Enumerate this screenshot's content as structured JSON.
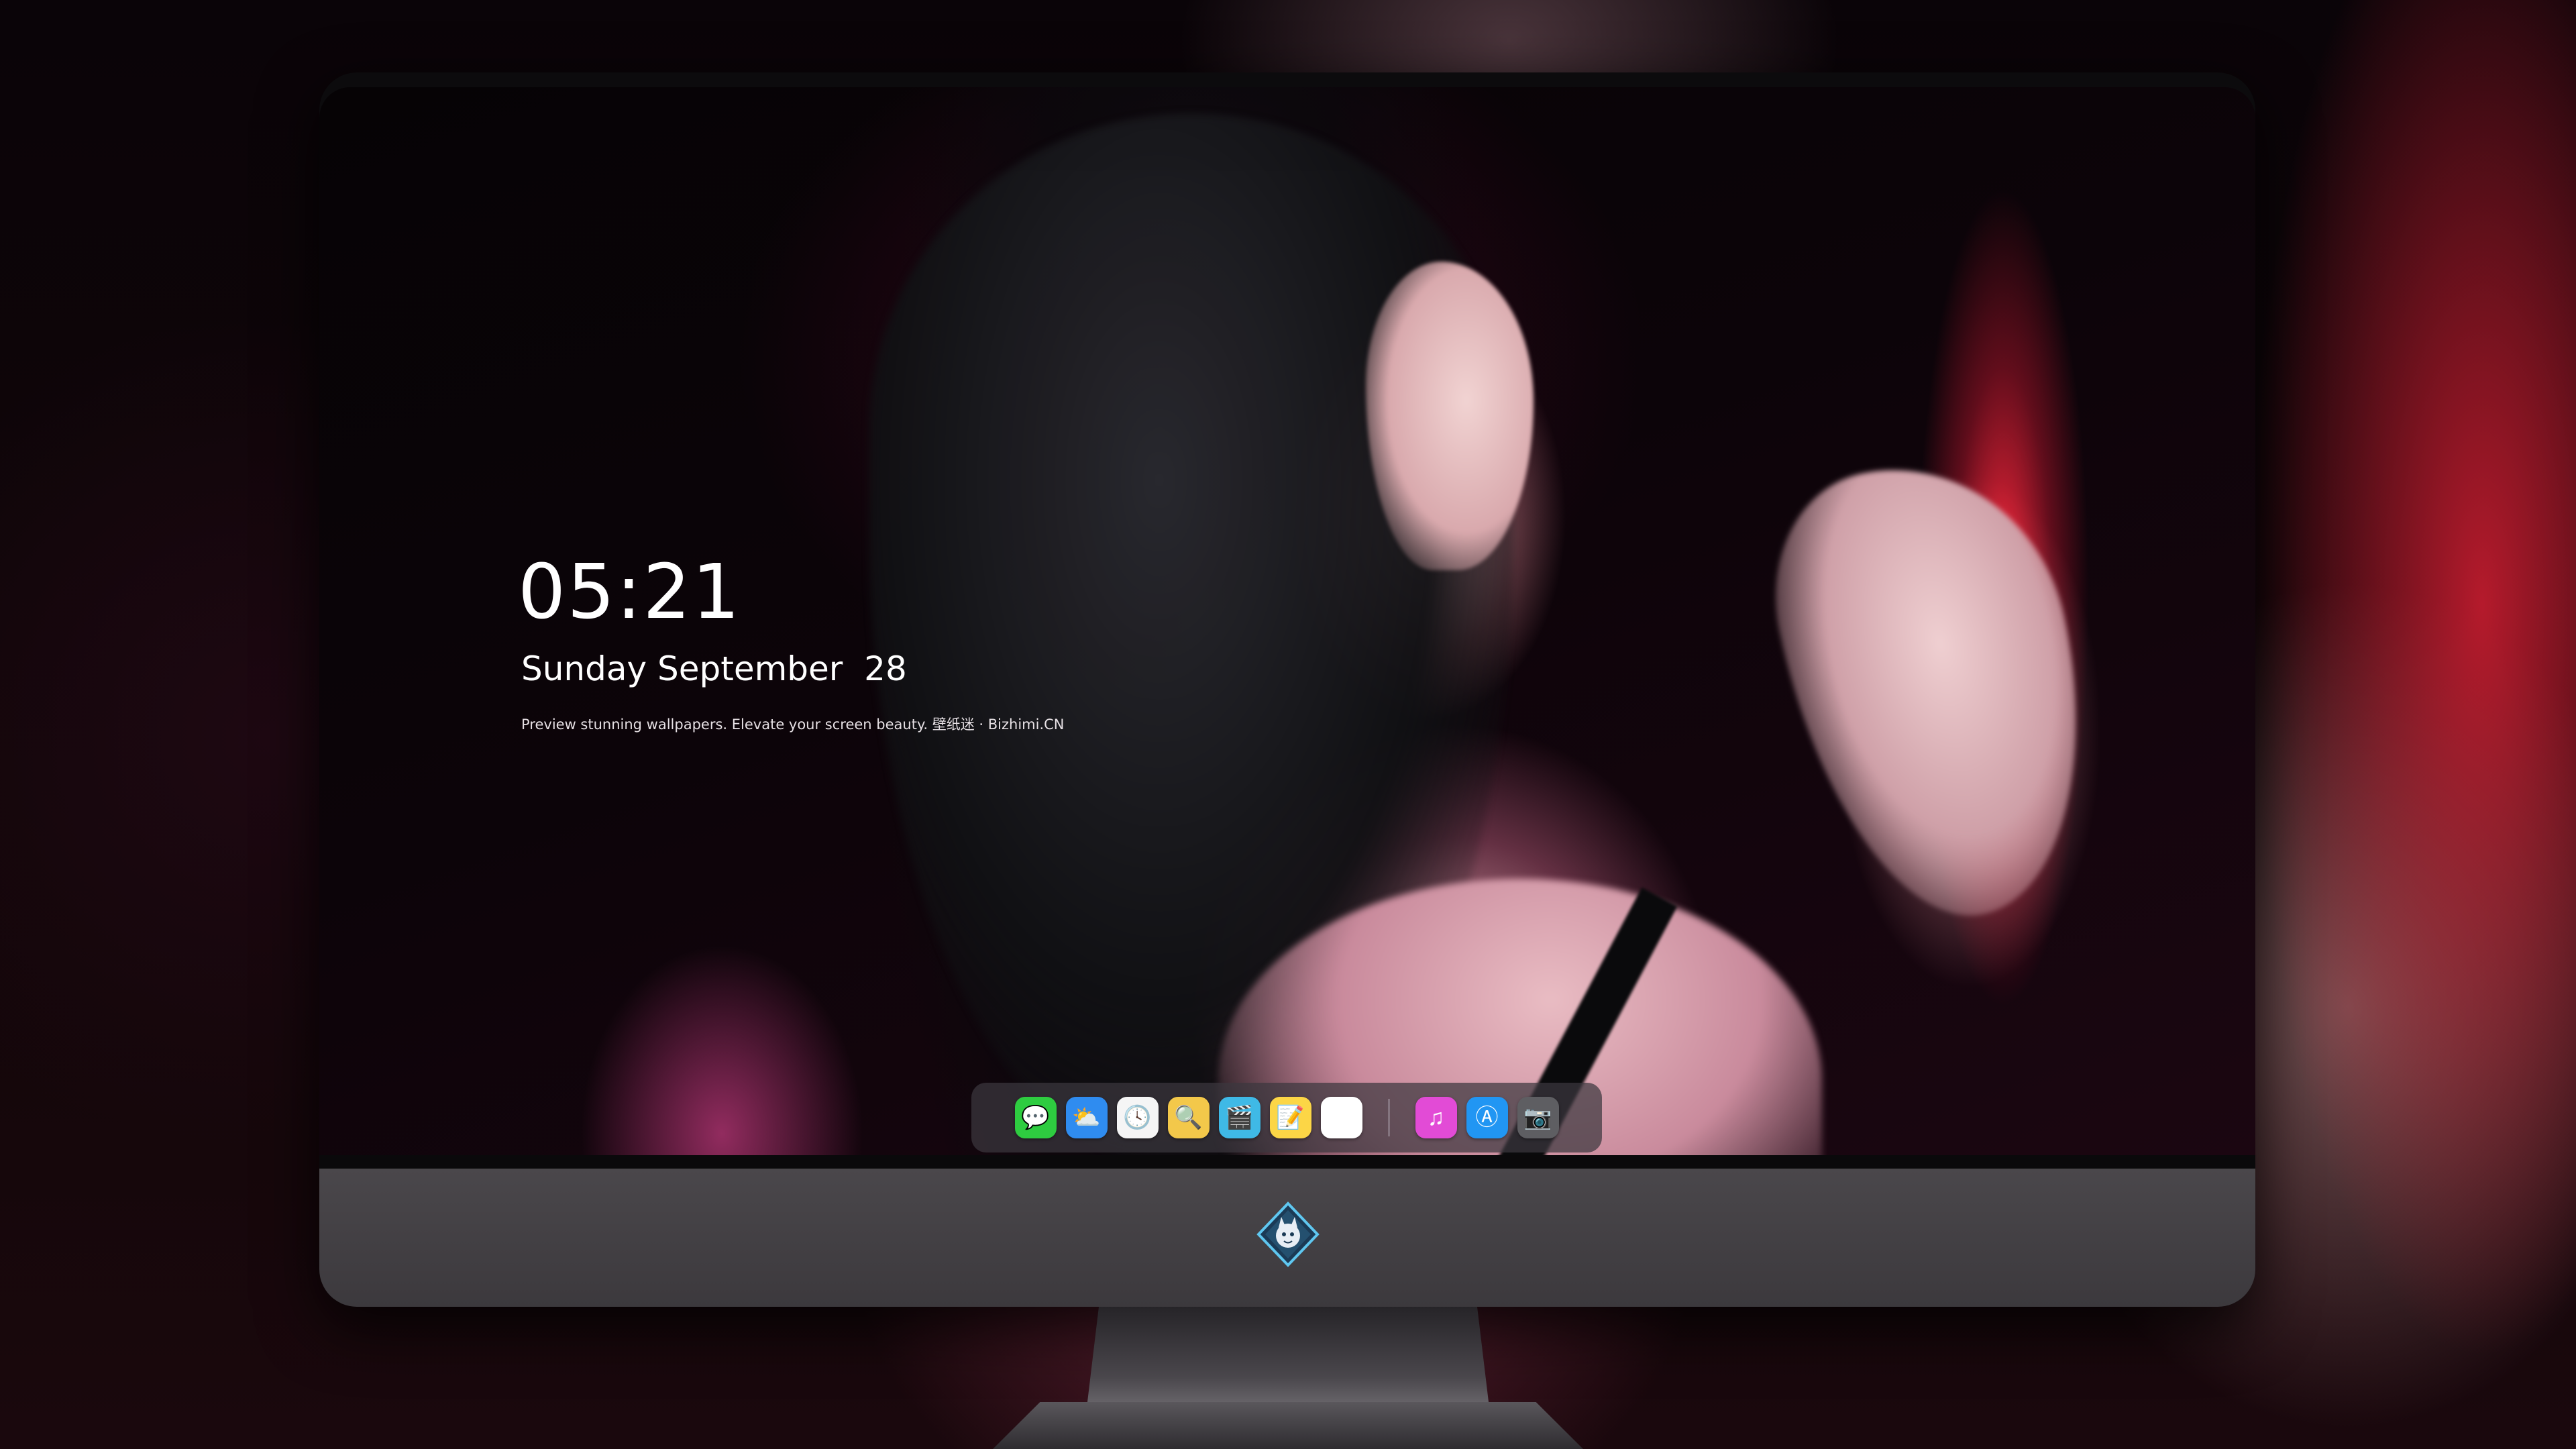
{
  "lockscreen": {
    "time": "05:21",
    "date": "Sunday September  28",
    "tagline": "Preview stunning wallpapers. Elevate your screen beauty. 壁纸迷 · Bizhimi.CN"
  },
  "dock": {
    "apps": [
      {
        "name": "messages-icon",
        "glyph": "💬",
        "bg": "#2ecc40"
      },
      {
        "name": "weather-icon",
        "glyph": "⛅",
        "bg": "#2f8cf0"
      },
      {
        "name": "clock-icon",
        "glyph": "🕓",
        "bg": "#f5f5f5"
      },
      {
        "name": "preview-icon",
        "glyph": "🔍",
        "bg": "#f3c84a"
      },
      {
        "name": "clips-icon",
        "glyph": "🎬",
        "bg": "#3fb9e6"
      },
      {
        "name": "notes-icon",
        "glyph": "📝",
        "bg": "#fcd646"
      },
      {
        "name": "photo-editor-icon",
        "glyph": "🖼",
        "bg": "#ffffff"
      }
    ],
    "pinned": [
      {
        "name": "music-icon",
        "glyph": "♫",
        "bg": "#e24bd6"
      },
      {
        "name": "app-store-icon",
        "glyph": "Ⓐ",
        "bg": "#2196f3"
      },
      {
        "name": "camera-icon",
        "glyph": "📷",
        "bg": "#5e5e62"
      }
    ]
  },
  "colors": {
    "accent_red": "#ff2a3c",
    "bezel": "#3f3c40"
  }
}
